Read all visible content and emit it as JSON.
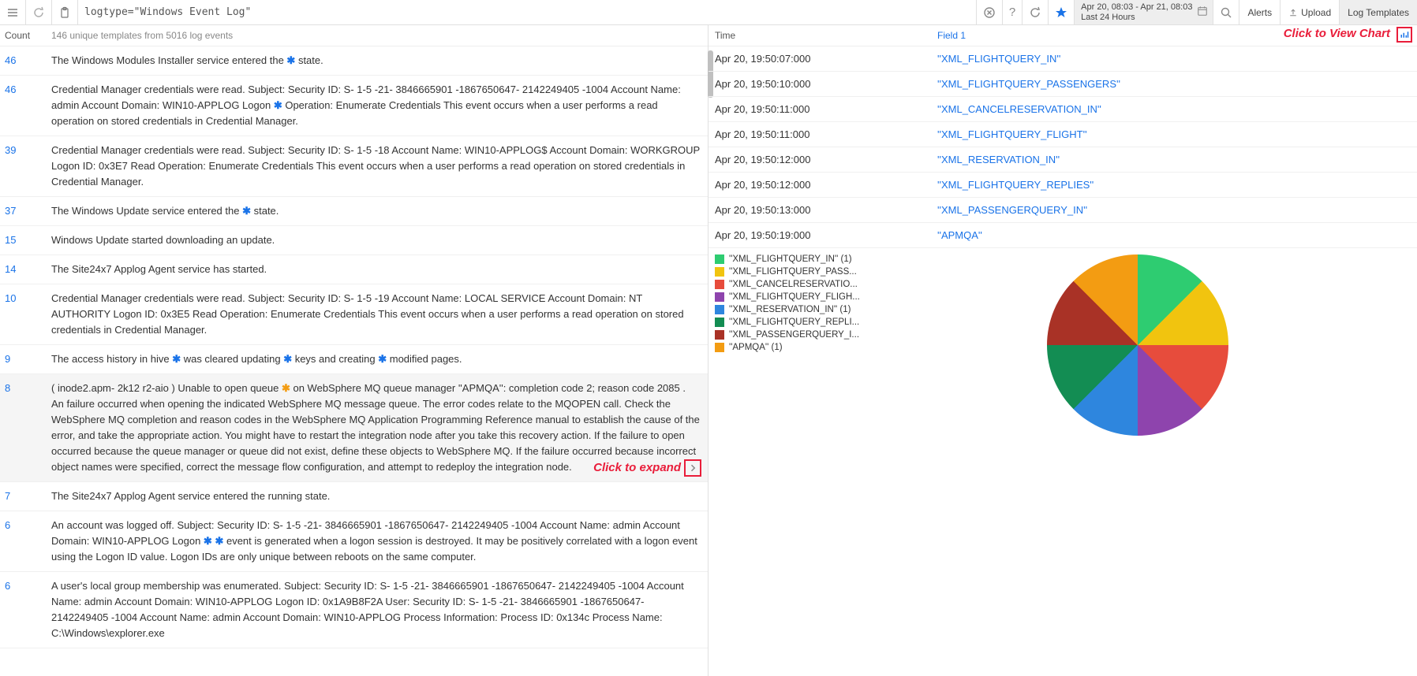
{
  "topbar": {
    "query": "logtype=\"Windows Event Log\"",
    "time_range_1": "Apr 20, 08:03 - Apr 21, 08:03",
    "time_range_2": "Last 24 Hours",
    "alerts": "Alerts",
    "upload": "Upload",
    "log_templates": "Log Templates"
  },
  "left_header": {
    "count": "Count",
    "summary": "146 unique templates from 5016 log events"
  },
  "templates": [
    {
      "count": "46",
      "msg_parts": [
        {
          "t": "The Windows Modules Installer service entered the "
        },
        {
          "w": "*"
        },
        {
          "t": " state."
        }
      ]
    },
    {
      "count": "46",
      "msg_parts": [
        {
          "t": "Credential Manager credentials were read. Subject: Security ID: S- 1-5 -21- 3846665901 -1867650647- 2142249405 -1004 Account Name: admin Account Domain: WIN10-APPLOG Logon "
        },
        {
          "w": "*"
        },
        {
          "t": " Operation: Enumerate Credentials This event occurs when a user performs a read operation on stored credentials in Credential Manager."
        }
      ]
    },
    {
      "count": "39",
      "msg_parts": [
        {
          "t": "Credential Manager credentials were read. Subject: Security ID: S- 1-5 -18 Account Name: WIN10-APPLOG$ Account Domain: WORKGROUP Logon ID: 0x3E7 Read Operation: Enumerate Credentials This event occurs when a user performs a read operation on stored credentials in Credential Manager."
        }
      ]
    },
    {
      "count": "37",
      "msg_parts": [
        {
          "t": "The Windows Update service entered the "
        },
        {
          "w": "*"
        },
        {
          "t": " state."
        }
      ]
    },
    {
      "count": "15",
      "msg_parts": [
        {
          "t": "Windows Update started downloading an update."
        }
      ]
    },
    {
      "count": "14",
      "msg_parts": [
        {
          "t": "The Site24x7 Applog Agent service has started."
        }
      ]
    },
    {
      "count": "10",
      "msg_parts": [
        {
          "t": "Credential Manager credentials were read. Subject: Security ID: S- 1-5 -19 Account Name: LOCAL SERVICE Account Domain: NT AUTHORITY Logon ID: 0x3E5 Read Operation: Enumerate Credentials This event occurs when a user performs a read operation on stored credentials in Credential Manager."
        }
      ]
    },
    {
      "count": "9",
      "msg_parts": [
        {
          "t": "The access history in hive "
        },
        {
          "w": "*"
        },
        {
          "t": " was cleared updating "
        },
        {
          "w": "*"
        },
        {
          "t": " keys and creating "
        },
        {
          "w": "*"
        },
        {
          "t": " modified pages."
        }
      ]
    },
    {
      "count": "8",
      "hover": true,
      "expand": true,
      "msg_parts": [
        {
          "t": "( inode2.apm- 2k12 r2-aio ) Unable to open queue "
        },
        {
          "w": "*",
          "orange": true
        },
        {
          "t": " on WebSphere MQ queue manager ''APMQA'': completion code 2; reason code 2085 . An failure occurred when opening the indicated WebSphere MQ message queue. The error codes relate to the MQOPEN call. Check the WebSphere MQ completion and reason codes in the WebSphere MQ Application Programming Reference manual to establish the cause of the error, and take the appropriate action. You might have to restart the integration node after you take this recovery action. If the failure to open occurred because the queue manager or queue did not exist, define these objects to WebSphere MQ. If the failure occurred because incorrect object names were specified, correct the message flow configuration, and attempt to redeploy the integration node."
        }
      ]
    },
    {
      "count": "7",
      "msg_parts": [
        {
          "t": "The Site24x7 Applog Agent service entered the running state."
        }
      ]
    },
    {
      "count": "6",
      "msg_parts": [
        {
          "t": "An account was logged off. Subject: Security ID: S- 1-5 -21- 3846665901 -1867650647- 2142249405 -1004 Account Name: admin Account Domain: WIN10-APPLOG Logon "
        },
        {
          "w": "*"
        },
        {
          "t": " "
        },
        {
          "w": "*"
        },
        {
          "t": " event is generated when a logon session is destroyed. It may be positively correlated with a logon event using the Logon ID value. Logon IDs are only unique between reboots on the same computer."
        }
      ]
    },
    {
      "count": "6",
      "msg_parts": [
        {
          "t": "A user's local group membership was enumerated. Subject: Security ID: S- 1-5 -21- 3846665901 -1867650647- 2142249405 -1004 Account Name: admin Account Domain: WIN10-APPLOG Logon ID: 0x1A9B8F2A User: Security ID: S- 1-5 -21- 3846665901 -1867650647- 2142249405 -1004 Account Name: admin Account Domain: WIN10-APPLOG Process Information: Process ID: 0x134c Process Name: C:\\Windows\\explorer.exe"
        }
      ]
    }
  ],
  "expand_label": "Click to expand",
  "right_header": {
    "time": "Time",
    "field1": "Field 1"
  },
  "view_chart_label": "Click to View Chart",
  "events": [
    {
      "time": "Apr 20, 19:50:07:000",
      "field1": "''XML_FLIGHTQUERY_IN''"
    },
    {
      "time": "Apr 20, 19:50:10:000",
      "field1": "''XML_FLIGHTQUERY_PASSENGERS''"
    },
    {
      "time": "Apr 20, 19:50:11:000",
      "field1": "''XML_CANCELRESERVATION_IN''"
    },
    {
      "time": "Apr 20, 19:50:11:000",
      "field1": "''XML_FLIGHTQUERY_FLIGHT''"
    },
    {
      "time": "Apr 20, 19:50:12:000",
      "field1": "''XML_RESERVATION_IN''"
    },
    {
      "time": "Apr 20, 19:50:12:000",
      "field1": "''XML_FLIGHTQUERY_REPLIES''"
    },
    {
      "time": "Apr 20, 19:50:13:000",
      "field1": "''XML_PASSENGERQUERY_IN''"
    },
    {
      "time": "Apr 20, 19:50:19:000",
      "field1": "''APMQA''"
    }
  ],
  "chart_data": {
    "type": "pie",
    "title": "",
    "series": [
      {
        "name": "''XML_FLIGHTQUERY_IN'' (1)",
        "value": 1,
        "color": "#2ecc71",
        "legend": "''XML_FLIGHTQUERY_IN'' (1)"
      },
      {
        "name": "''XML_FLIGHTQUERY_PASSENGERS'' (1)",
        "value": 1,
        "color": "#f1c40f",
        "legend": "''XML_FLIGHTQUERY_PASS..."
      },
      {
        "name": "''XML_CANCELRESERVATION_IN'' (1)",
        "value": 1,
        "color": "#e74c3c",
        "legend": "''XML_CANCELRESERVATIO..."
      },
      {
        "name": "''XML_FLIGHTQUERY_FLIGHT'' (1)",
        "value": 1,
        "color": "#8e44ad",
        "legend": "''XML_FLIGHTQUERY_FLIGH..."
      },
      {
        "name": "''XML_RESERVATION_IN'' (1)",
        "value": 1,
        "color": "#2e86de",
        "legend": "''XML_RESERVATION_IN'' (1)"
      },
      {
        "name": "''XML_FLIGHTQUERY_REPLIES'' (1)",
        "value": 1,
        "color": "#138d53",
        "legend": "''XML_FLIGHTQUERY_REPLI..."
      },
      {
        "name": "''XML_PASSENGERQUERY_IN'' (1)",
        "value": 1,
        "color": "#a93226",
        "legend": "''XML_PASSENGERQUERY_I..."
      },
      {
        "name": "''APMQA'' (1)",
        "value": 1,
        "color": "#f39c12",
        "legend": "''APMQA'' (1)"
      }
    ]
  }
}
